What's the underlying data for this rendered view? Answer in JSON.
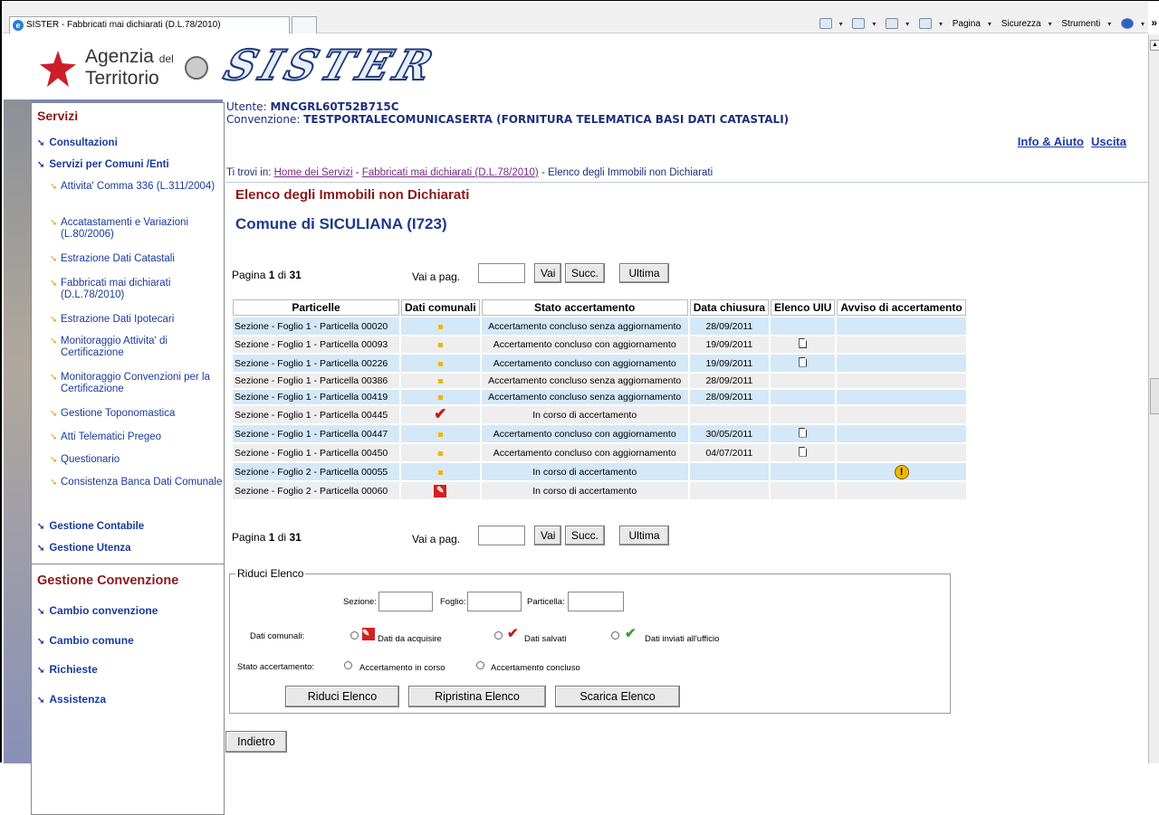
{
  "browser": {
    "tab_title": "SISTER - Fabbricati mai dichiarati (D.L.78/2010)",
    "tools": [
      "Pagina",
      "Sicurezza",
      "Strumenti"
    ]
  },
  "header": {
    "logo_line1": "Agenzia",
    "logo_small": "del",
    "logo_line2": "Territorio",
    "brand": "SISTER"
  },
  "sidebar": {
    "servizi_title": "Servizi",
    "items": [
      {
        "label": "Consultazioni"
      },
      {
        "label": "Servizi per Comuni /Enti"
      }
    ],
    "sub_items": [
      {
        "label": "Attivita' Comma 336 (L.311/2004)"
      },
      {
        "label": "Accatastamenti e Variazioni (L.80/2006)"
      },
      {
        "label": "Estrazione Dati Catastali"
      },
      {
        "label": "Fabbricati mai dichiarati (D.L.78/2010)"
      },
      {
        "label": "Estrazione Dati Ipotecari"
      },
      {
        "label": "Monitoraggio Attivita' di Certificazione"
      },
      {
        "label": "Monitoraggio Convenzioni per la Certificazione"
      },
      {
        "label": "Gestione Toponomastica"
      },
      {
        "label": "Atti Telematici Pregeo"
      },
      {
        "label": "Questionario"
      },
      {
        "label": "Consistenza Banca Dati Comunale"
      }
    ],
    "bottom_items": [
      {
        "label": "Gestione Contabile"
      },
      {
        "label": "Gestione Utenza"
      }
    ],
    "convenzione_title": "Gestione Convenzione",
    "convenzione_items": [
      {
        "label": "Cambio convenzione"
      },
      {
        "label": "Cambio comune"
      },
      {
        "label": "Richieste"
      },
      {
        "label": "Assistenza"
      }
    ]
  },
  "user": {
    "utente_label": "Utente:",
    "utente": "MNCGRL60T52B715C",
    "convenzione_label": "Convenzione:",
    "convenzione": "TESTPORTALECOMUNICASERTA (FORNITURA TELEMATICA BASI DATI CATASTALI)"
  },
  "topright": {
    "info": "Info & Aiuto",
    "uscita": "Uscita"
  },
  "breadcrumb": {
    "prefix": "Ti trovi in:",
    "home": "Home dei Servizi",
    "section": "Fabbricati mai dichiarati (D.L.78/2010)",
    "current": "- Elenco degli Immobili non Dichiarati",
    "sep": "-"
  },
  "page": {
    "title": "Elenco degli Immobili non Dichiarati",
    "subtitle": "Comune di SICULIANA (I723)"
  },
  "pager": {
    "pagina": "Pagina",
    "current": "1",
    "di": "di",
    "total": "31",
    "goto_label": "Vai a pag.",
    "vai": "Vai",
    "succ": "Succ.",
    "ultima": "Ultima"
  },
  "table": {
    "headers": [
      "Particelle",
      "Dati comunali",
      "Stato accertamento",
      "Data chiusura",
      "Elenco UIU",
      "Avviso di accertamento"
    ],
    "rows": [
      {
        "particella": "Sezione  -  Foglio 1 -  Particella 00020",
        "dati": "square",
        "stato": "Accertamento concluso senza aggiornamento",
        "data": "28/09/2011",
        "uiu": "",
        "avviso": ""
      },
      {
        "particella": "Sezione  -  Foglio 1 -  Particella 00093",
        "dati": "square",
        "stato": "Accertamento concluso con aggiornamento",
        "data": "19/09/2011",
        "uiu": "doc",
        "avviso": ""
      },
      {
        "particella": "Sezione  -  Foglio 1 -  Particella 00226",
        "dati": "square",
        "stato": "Accertamento concluso con aggiornamento",
        "data": "19/09/2011",
        "uiu": "doc",
        "avviso": ""
      },
      {
        "particella": "Sezione  -  Foglio 1 -  Particella 00386",
        "dati": "square",
        "stato": "Accertamento concluso senza aggiornamento",
        "data": "28/09/2011",
        "uiu": "",
        "avviso": ""
      },
      {
        "particella": "Sezione  -  Foglio 1 -  Particella 00419",
        "dati": "square",
        "stato": "Accertamento concluso senza aggiornamento",
        "data": "28/09/2011",
        "uiu": "",
        "avviso": ""
      },
      {
        "particella": "Sezione  -  Foglio 1 -  Particella 00445",
        "dati": "check",
        "stato": "In corso di accertamento",
        "data": "",
        "uiu": "",
        "avviso": ""
      },
      {
        "particella": "Sezione  -  Foglio 1 -  Particella 00447",
        "dati": "square",
        "stato": "Accertamento concluso con aggiornamento",
        "data": "30/05/2011",
        "uiu": "doc",
        "avviso": ""
      },
      {
        "particella": "Sezione  -  Foglio 1 -  Particella 00450",
        "dati": "square",
        "stato": "Accertamento concluso con aggiornamento",
        "data": "04/07/2011",
        "uiu": "doc",
        "avviso": ""
      },
      {
        "particella": "Sezione  -  Foglio 2 -  Particella 00055",
        "dati": "square",
        "stato": "In corso di accertamento",
        "data": "",
        "uiu": "",
        "avviso": "warn"
      },
      {
        "particella": "Sezione  -  Foglio 2 -  Particella 00060",
        "dati": "edit",
        "stato": "In corso di accertamento",
        "data": "",
        "uiu": "",
        "avviso": ""
      }
    ]
  },
  "filter": {
    "legend": "Riduci Elenco",
    "sezione": "Sezione:",
    "foglio": "Foglio:",
    "particella": "Particella:",
    "dati_label": "Dati comunali:",
    "opt_acquisire": "Dati da acquisire",
    "opt_salvati": "Dati salvati",
    "opt_inviati": "Dati inviati all'ufficio",
    "stato_label": "Stato accertamento:",
    "opt_corso": "Accertamento in corso",
    "opt_concluso": "Accertamento concluso",
    "btn_riduci": "Riduci Elenco",
    "btn_ripristina": "Ripristina Elenco",
    "btn_scarica": "Scarica Elenco"
  },
  "indietro": "Indietro"
}
